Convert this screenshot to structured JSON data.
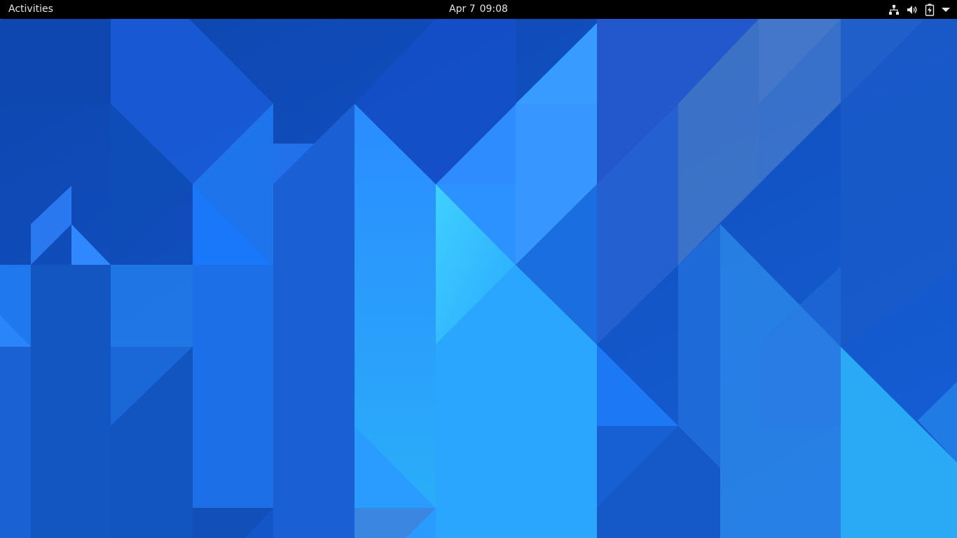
{
  "top_bar": {
    "activities_label": "Activities",
    "clock": {
      "date": "Apr 7",
      "time": "09:08"
    },
    "tray_icons": [
      "network-wired-icon",
      "volume-icon",
      "battery-charging-icon",
      "system-menu-arrow-icon"
    ]
  },
  "desktop": {
    "wallpaper": "blue geometric triangles",
    "colors": {
      "base": "#1553c8",
      "dark": "#0f47b0",
      "mid": "#1e6fe0",
      "light": "#2aa0ff",
      "cyan": "#3fc8ff",
      "steel": "#4a7dc8"
    }
  }
}
